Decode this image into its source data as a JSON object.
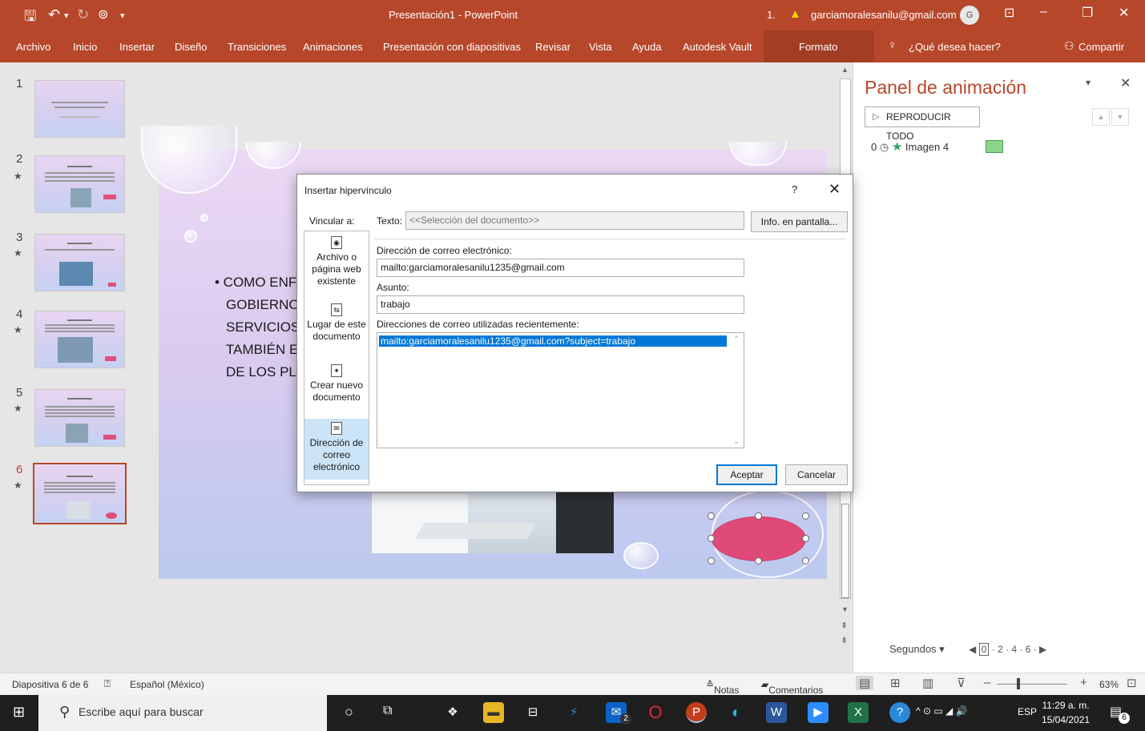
{
  "app": {
    "window_title": "Presentación1 - PowerPoint",
    "account_email": "garciamoralesanilu@gmail.com",
    "account_prefix": "1.",
    "avatar_initial": "G",
    "accent": "#b7472a"
  },
  "ribbon": {
    "tabs": [
      "Archivo",
      "Inicio",
      "Insertar",
      "Diseño",
      "Transiciones",
      "Animaciones",
      "Presentación con diapositivas",
      "Revisar",
      "Vista",
      "Ayuda",
      "Autodesk Vault",
      "Formato"
    ],
    "tell_me": "¿Qué desea hacer?",
    "share": "Compartir"
  },
  "thumbnails": {
    "numbers": [
      "1",
      "2",
      "3",
      "4",
      "5",
      "6"
    ],
    "selected": "6"
  },
  "slide": {
    "bullet_lines": [
      "• COMO ENFE",
      "GOBIERNO I",
      "SERVICIOS D",
      "TAMBIÉN EST",
      "DE LOS PLAN"
    ]
  },
  "animation_pane": {
    "title": "Panel de animación",
    "play_all": "REPRODUCIR TODO",
    "item": {
      "order": "0",
      "name": "Imagen 4"
    },
    "seconds_label": "Segundos",
    "ticks": [
      "0",
      "2",
      "4",
      "6"
    ]
  },
  "dialog": {
    "title": "Insertar hipervínculo",
    "help": "?",
    "link_to": "Vincular a:",
    "options": {
      "file": "Archivo o página web existente",
      "place": "Lugar de este documento",
      "new_doc": "Crear nuevo documento",
      "email": "Dirección de correo electrónico"
    },
    "text_label": "Texto:",
    "text_value": "<<Selección del documento>>",
    "screen_tip_button": "Info. en pantalla...",
    "email_label": "Dirección de correo electrónico:",
    "email_value": "mailto:garciamoralesanilu1235@gmail.com",
    "subject_label": "Asunto:",
    "subject_value": "trabajo",
    "recent_label": "Direcciones de correo utilizadas recientemente:",
    "recent_items": [
      "mailto:garciamoralesanilu1235@gmail.com?subject=trabajo"
    ],
    "ok": "Aceptar",
    "cancel": "Cancelar"
  },
  "statusbar": {
    "slide_info": "Diapositiva 6 de 6",
    "language": "Español (México)",
    "notes": "Notas",
    "comments": "Comentarios",
    "zoom": "63%"
  },
  "taskbar": {
    "search_placeholder": "Escribe aquí para buscar",
    "mail_badge": "2",
    "lang": "ESP",
    "time": "11:29 a. m.",
    "date": "15/04/2021",
    "notifications": "6"
  }
}
